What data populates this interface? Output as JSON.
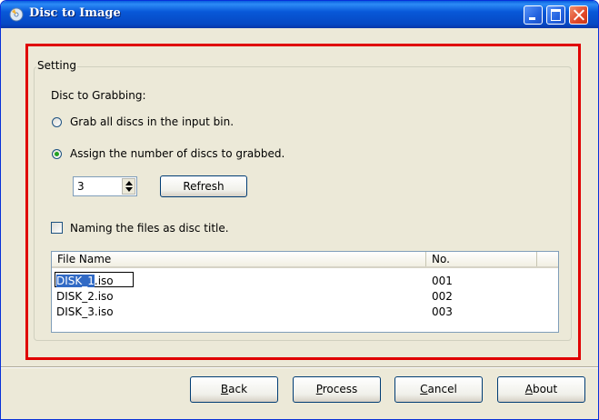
{
  "window": {
    "title": "Disc to Image"
  },
  "setting": {
    "group_title": "Setting",
    "section_label": "Disc to Grabbing:",
    "radio_all_label": "Grab all discs in the input bin.",
    "radio_assign_label": "Assign the number of discs to grabbed.",
    "disc_count": "3",
    "refresh_label": "Refresh",
    "naming_label": "Naming the files as disc title."
  },
  "list": {
    "headers": [
      "File Name",
      "No."
    ],
    "rows": [
      {
        "name_selected": "DISK_1",
        "name_suffix": ".iso",
        "no": "001"
      },
      {
        "name": "DISK_2.iso",
        "no": "002"
      },
      {
        "name": "DISK_3.iso",
        "no": "003"
      }
    ]
  },
  "buttons": {
    "back_mnemonic": "B",
    "back_rest": "ack",
    "process_mnemonic": "P",
    "process_rest": "rocess",
    "cancel_mnemonic": "C",
    "cancel_rest": "ancel",
    "about_mnemonic": "A",
    "about_rest": "bout"
  },
  "colors": {
    "highlight_frame": "#e00000",
    "title_bar": "#0858d8",
    "selection": "#316ac5"
  },
  "state": {
    "selected_radio": "assign",
    "naming_checked": false
  }
}
